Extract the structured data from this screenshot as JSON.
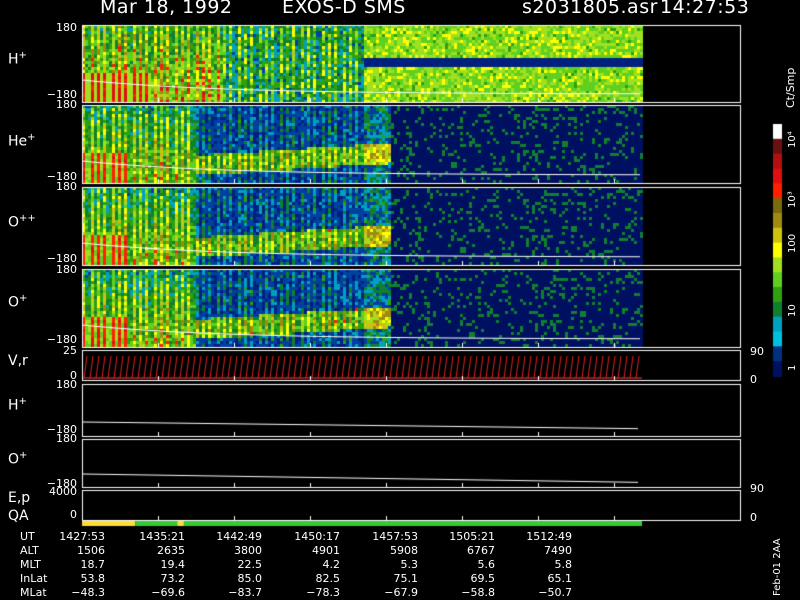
{
  "header": {
    "date": "Mar 18, 1992",
    "instrument": "EXOS-D SMS",
    "file": "s2031805.asr",
    "time": "14:27:53"
  },
  "panels": [
    {
      "name": "H",
      "sup": "+",
      "ymax": "180",
      "ymin": "−180"
    },
    {
      "name": "He",
      "sup": "+",
      "ymax": "180",
      "ymin": "−180"
    },
    {
      "name": "O",
      "sup": "++",
      "ymax": "180",
      "ymin": "−180"
    },
    {
      "name": "O",
      "sup": "+",
      "ymax": "180",
      "ymin": "−180"
    }
  ],
  "vr_panel": {
    "label": "V,r",
    "ymax": "25",
    "ymin": "0",
    "right_top": "90",
    "right_bottom": "0"
  },
  "h_line_panel": {
    "name": "H",
    "sup": "+",
    "ymax": "180",
    "ymin": "−180"
  },
  "o_line_panel": {
    "name": "O",
    "sup": "+",
    "ymax": "180",
    "ymin": "−180"
  },
  "ep_panel": {
    "label": "E,p",
    "ymax": "4000",
    "ymin": "0",
    "right_top": "90",
    "right_bottom": "0"
  },
  "qa_label": "QA",
  "colorbar": {
    "unit": "Ct/Smp",
    "ticks": [
      "10⁴",
      "10³",
      "100",
      "10",
      "1"
    ],
    "colors": [
      "#ffffff",
      "#6b1010",
      "#b01010",
      "#e01010",
      "#ff2000",
      "#7a6a10",
      "#a08a10",
      "#d0c010",
      "#ffff00",
      "#a0e020",
      "#60d020",
      "#30a010",
      "#108030",
      "#00a0c0",
      "#00c0e0",
      "#003080",
      "#001060"
    ]
  },
  "qa_segments": [
    {
      "from": 0.0,
      "to": 0.095,
      "color": "#ffdd33"
    },
    {
      "from": 0.095,
      "to": 0.17,
      "color": "#33cc33"
    },
    {
      "from": 0.17,
      "to": 0.182,
      "color": "#ffdd33"
    },
    {
      "from": 0.182,
      "to": 1.0,
      "color": "#33cc33"
    }
  ],
  "orbit_table": {
    "rows": [
      {
        "label": "UT",
        "values": [
          "1427:53",
          "1435:21",
          "1442:49",
          "1450:17",
          "1457:53",
          "1505:21",
          "1512:49"
        ]
      },
      {
        "label": "ALT",
        "values": [
          "1506",
          "2635",
          "3800",
          "4901",
          "5908",
          "6767",
          "7490"
        ]
      },
      {
        "label": "MLT",
        "values": [
          "18.7",
          "19.4",
          "22.5",
          "4.2",
          "5.3",
          "5.6",
          "5.8"
        ]
      },
      {
        "label": "InLat",
        "values": [
          "53.8",
          "73.2",
          "85.0",
          "82.5",
          "75.1",
          "69.5",
          "65.1"
        ]
      },
      {
        "label": "MLat",
        "values": [
          "−48.3",
          "−69.6",
          "−83.7",
          "−78.3",
          "−67.9",
          "−58.8",
          "−50.7"
        ]
      }
    ]
  },
  "footer_stamp": "Feb-01 2AA",
  "chart_data": {
    "type": "heatmap",
    "title": "Mar 18, 1992   EXOS-D SMS",
    "xlabel": "UT",
    "x_ticks": [
      "1427:53",
      "1435:21",
      "1442:49",
      "1450:17",
      "1457:53",
      "1505:21",
      "1512:49"
    ],
    "panels": [
      {
        "series": "H+",
        "ylim": [
          -180,
          180
        ]
      },
      {
        "series": "He+",
        "ylim": [
          -180,
          180
        ]
      },
      {
        "series": "O++",
        "ylim": [
          -180,
          180
        ]
      },
      {
        "series": "O+",
        "ylim": [
          -180,
          180
        ]
      },
      {
        "series": "V,r",
        "ylim": [
          0,
          25
        ]
      },
      {
        "series": "H+",
        "ylim": [
          -180,
          180
        ]
      },
      {
        "series": "O+",
        "ylim": [
          -180,
          180
        ]
      },
      {
        "series": "E,p",
        "ylim": [
          0,
          4000
        ]
      }
    ],
    "colorbar_label": "Ct/Smp",
    "colorbar_ticks": [
      "1",
      "10",
      "100",
      "10^3",
      "10^4"
    ]
  }
}
